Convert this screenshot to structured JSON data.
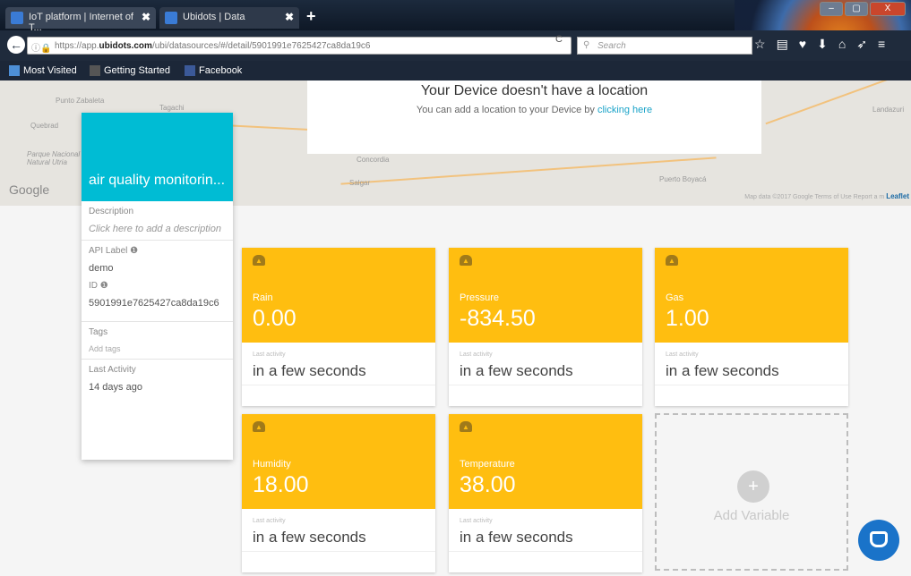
{
  "browser": {
    "tabs": [
      {
        "label": "IoT platform | Internet of T...",
        "close": "✖"
      },
      {
        "label": "Ubidots | Data",
        "close": "✖"
      }
    ],
    "new_tab": "+",
    "url_prefix": "https://app.",
    "url_domain": "ubidots.com",
    "url_path": "/ubi/datasources/#/detail/5901991e7625427ca8da19c6",
    "search_placeholder": "Search",
    "bookmarks": [
      "Most Visited",
      "Getting Started",
      "Facebook"
    ],
    "window_buttons": [
      "–",
      "▢",
      "X"
    ]
  },
  "map": {
    "labels": [
      "Punto Zabaleta",
      "Tagachi",
      "Quebrad",
      "Parque Nacional Natural Utria",
      "Concordia",
      "Salgar",
      "Puerto Boyacá",
      "Landazuri"
    ],
    "google": "Google",
    "footer": "Map data ©2017 Google   Terms of Use   Report a m",
    "leaflet": "Leaflet"
  },
  "location_notice": {
    "title": "Your Device doesn't have a location",
    "text": "You can add a location to your Device by ",
    "link": "clicking here"
  },
  "device": {
    "name": "air quality monitorin...",
    "description_label": "Description",
    "description_placeholder": "Click here to add a description",
    "api_label_label": "API Label",
    "api_label_value": "demo",
    "id_label": "ID",
    "id_value": "5901991e7625427ca8da19c6",
    "tags_label": "Tags",
    "tags_placeholder": "Add tags",
    "last_activity_label": "Last Activity",
    "last_activity_value": "14 days ago"
  },
  "variables": [
    {
      "name": "Rain",
      "value": "0.00",
      "last_label": "Last activity",
      "last_value": "in a few seconds"
    },
    {
      "name": "Pressure",
      "value": "-834.50",
      "last_label": "Last activity",
      "last_value": "in a few seconds"
    },
    {
      "name": "Gas",
      "value": "1.00",
      "last_label": "Last activity",
      "last_value": "in a few seconds"
    },
    {
      "name": "Humidity",
      "value": "18.00",
      "last_label": "Last activity",
      "last_value": "in a few seconds"
    },
    {
      "name": "Temperature",
      "value": "38.00",
      "last_label": "Last activity",
      "last_value": "in a few seconds"
    }
  ],
  "add_variable": {
    "label": "Add Variable",
    "icon": "+"
  },
  "colors": {
    "device_header": "#00bcd4",
    "variable_card": "#ffbe10",
    "link": "#1aa3c8",
    "chat": "#1a73c9"
  }
}
